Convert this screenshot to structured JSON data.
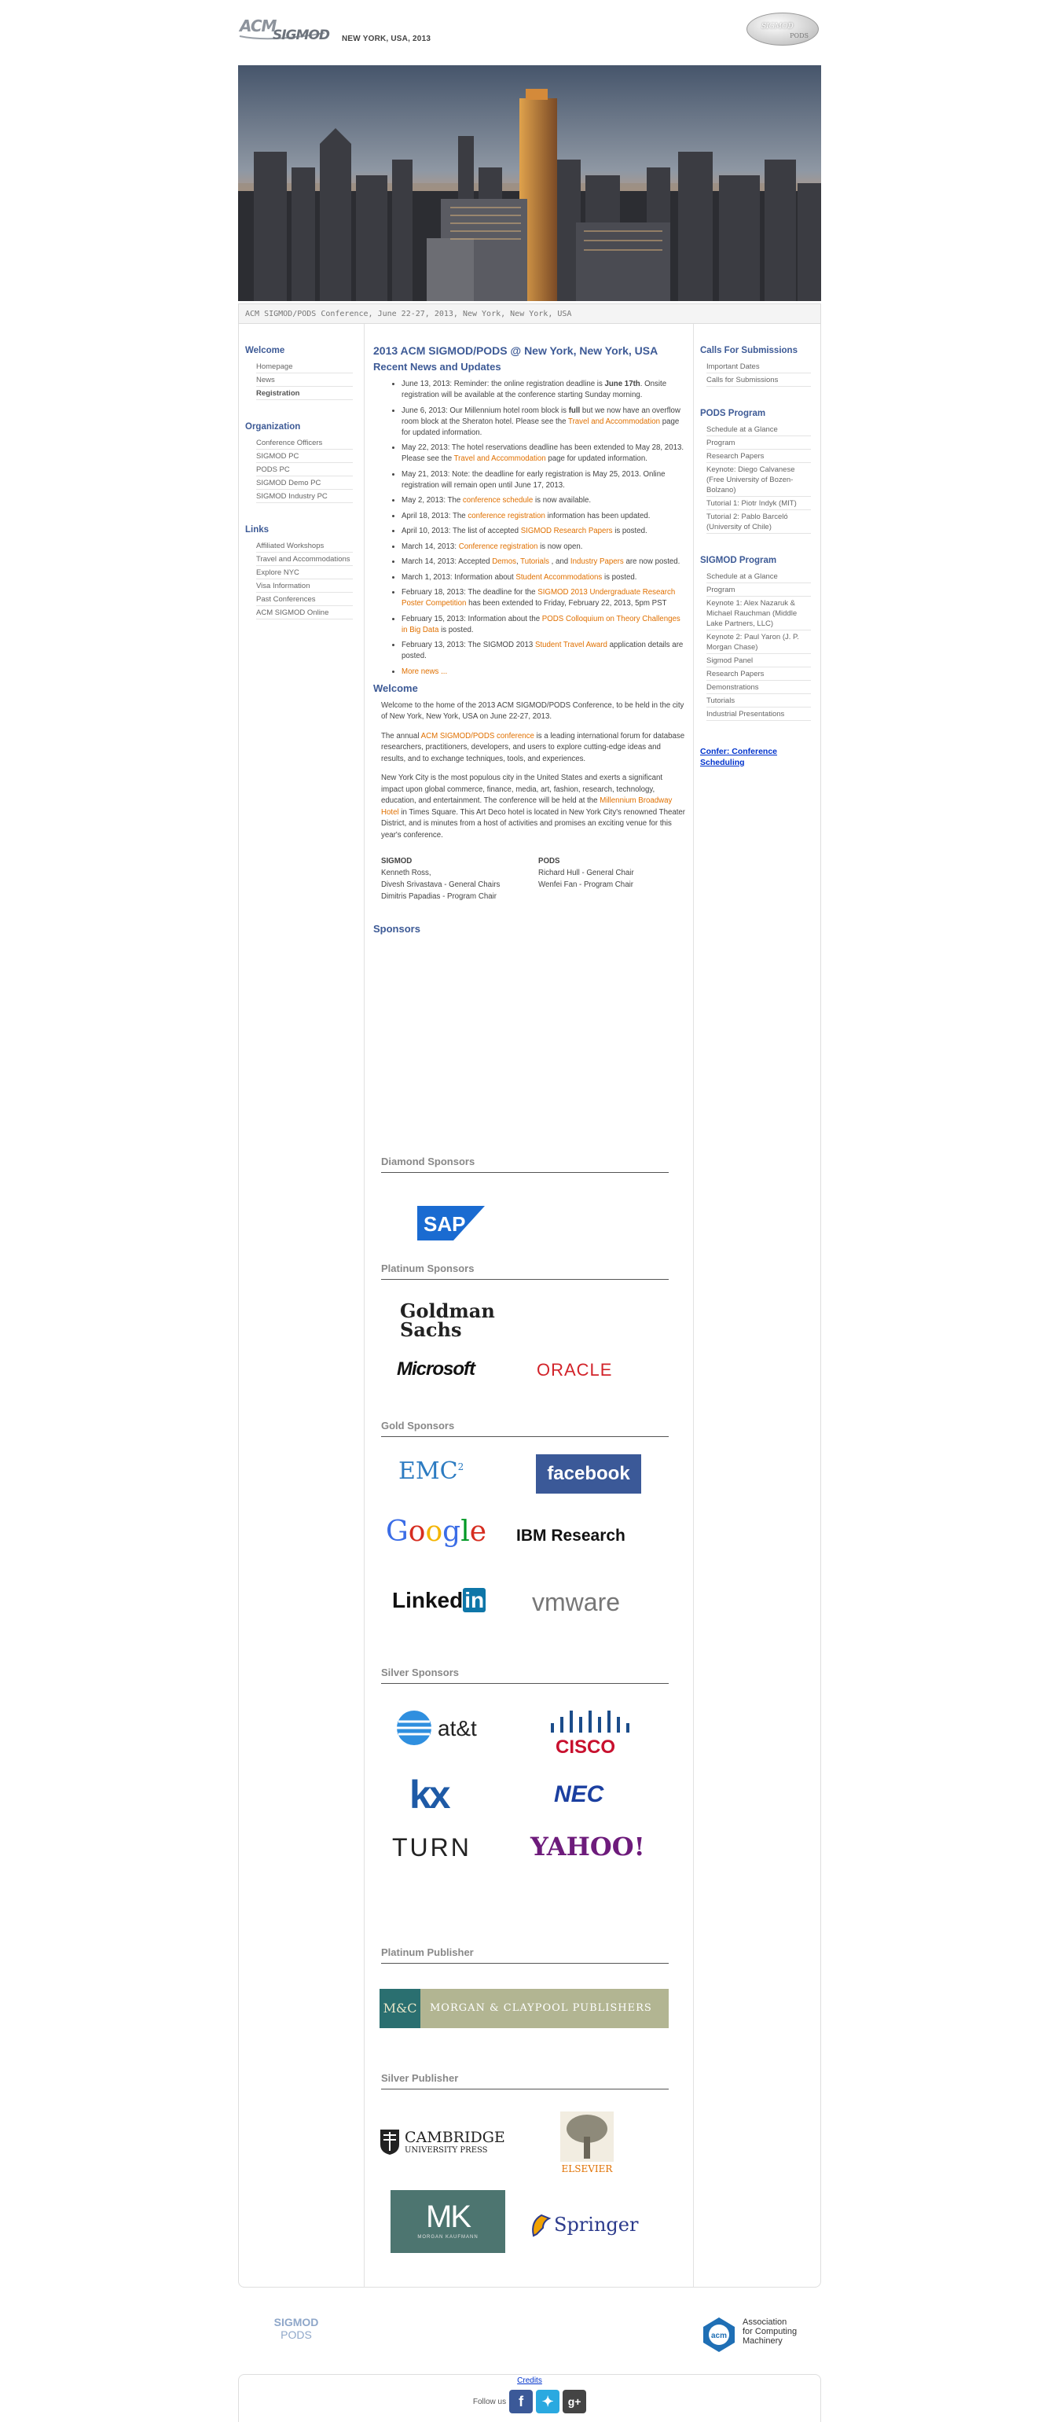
{
  "header": {
    "title": "NEW YORK, USA, 2013",
    "acm_logo_text": "ACM SIGMOD",
    "badge_top": "SIGMOD",
    "badge_bottom": "PODS"
  },
  "caption": "ACM SIGMOD/PODS Conference, June 22-27, 2013, New York, New York, USA",
  "left_sidebar": {
    "sections": [
      {
        "heading": "Welcome",
        "items": [
          "Homepage",
          "News",
          "Registration"
        ]
      },
      {
        "heading": "Organization",
        "items": [
          "Conference Officers",
          "SIGMOD PC",
          "PODS PC",
          "SIGMOD Demo PC",
          "SIGMOD Industry PC"
        ]
      },
      {
        "heading": "Links",
        "items": [
          "Affiliated Workshops",
          "Travel and Accommodations",
          "Explore NYC",
          "Visa Information",
          "Past Conferences",
          "ACM SIGMOD Online"
        ]
      }
    ]
  },
  "right_sidebar": {
    "sections": [
      {
        "heading": "Calls For Submissions",
        "items": [
          "Important Dates",
          "Calls for Submissions"
        ]
      },
      {
        "heading": "PODS Program",
        "items": [
          "Schedule at a Glance",
          "Program",
          "Research Papers",
          "Keynote: Diego Calvanese (Free University of Bozen-Bolzano)",
          "Tutorial 1: Piotr Indyk (MIT)",
          "Tutorial 2: Pablo Barceló (University of Chile)"
        ]
      },
      {
        "heading": "SIGMOD Program",
        "items": [
          "Schedule at a Glance",
          "Program",
          "Keynote 1: Alex Nazaruk & Michael Rauchman (Middle Lake Partners, LLC)",
          "Keynote 2: Paul Yaron (J. P. Morgan Chase)",
          "Sigmod Panel",
          "Research Papers",
          "Demonstrations",
          "Tutorials",
          "Industrial Presentations"
        ]
      }
    ],
    "confer_link": "Confer: Conference Scheduling"
  },
  "main": {
    "title": "2013 ACM SIGMOD/PODS @ New York, New York, USA",
    "news_heading": "Recent News and Updates",
    "news": [
      {
        "pre": "June 13, 2013: Reminder: the online registration deadline is ",
        "bold": "June 17th",
        "post": ". Onsite registration will be available at the conference starting Sunday morning."
      },
      {
        "pre": "June 6, 2013: Our Millennium hotel room block is ",
        "bold": "full",
        "post": " but we now have an overflow room block at the Sheraton hotel. Please see the ",
        "link": "Travel and Accommodation",
        "post2": " page for updated information."
      },
      {
        "pre": "May 22, 2013: The hotel reservations deadline has been extended to May 28, 2013. Please see the ",
        "link": "Travel and Accommodation",
        "post": " page for updated information."
      },
      {
        "pre": "May 21, 2013: Note: the deadline for early registration is May 25, 2013. Online registration will remain open until June 17, 2013."
      },
      {
        "pre": "May 2, 2013: The ",
        "link": "conference schedule",
        "post": " is now available."
      },
      {
        "pre": "April 18, 2013: The ",
        "link": "conference registration",
        "post": " information has been updated."
      },
      {
        "pre": "April 10, 2013: The list of accepted ",
        "link": "SIGMOD Research Papers",
        "post": " is posted."
      },
      {
        "pre": "March 14, 2013: ",
        "link": "Conference registration",
        "post": " is now open."
      },
      {
        "pre": "March 14, 2013: Accepted ",
        "link": "Demos",
        "mid": ", ",
        "link2": "Tutorials",
        "mid2": " , and ",
        "link3": "Industry Papers",
        "post": " are now posted."
      },
      {
        "pre": "March 1, 2013: Information about ",
        "link": "Student Accommodations",
        "post": " is posted."
      },
      {
        "pre": "February 18, 2013: The deadline for the ",
        "link": "SIGMOD 2013 Undergraduate Research Poster Competition",
        "post": " has been extended to Friday, February 22, 2013, 5pm PST"
      },
      {
        "pre": "February 15, 2013: Information about the ",
        "link": "PODS Colloquium on Theory Challenges in Big Data",
        "post": " is posted."
      },
      {
        "pre": "February 13, 2013: The SIGMOD 2013 ",
        "link": "Student Travel Award",
        "post": " application details are posted."
      },
      {
        "link": "More news ..."
      }
    ],
    "welcome_heading": "Welcome",
    "welcome_p1": "Welcome to the home of the 2013 ACM SIGMOD/PODS Conference, to be held in the city of New York, New York, USA on June 22-27, 2013.",
    "welcome_p2_pre": "The annual ",
    "welcome_p2_link": "ACM SIGMOD/PODS conference",
    "welcome_p2_post": " is a leading international forum for database researchers, practitioners, developers, and users to explore cutting-edge ideas and results, and to exchange techniques, tools, and experiences.",
    "welcome_p3_pre": "New York City is the most populous city in the United States and exerts a significant impact upon global commerce, finance, media, art, fashion, research, technology, education, and entertainment. The conference will be held at the ",
    "welcome_p3_link": "Millennium Broadway Hotel",
    "welcome_p3_post": " in Times Square. This Art Deco hotel is located in New York City's renowned Theater District, and is minutes from a host of activities and promises an exciting venue for this year's conference.",
    "chairs": {
      "sigmod_h": "SIGMOD",
      "sigmod_1": "Kenneth Ross,",
      "sigmod_2": "Divesh Srivastava - General Chairs",
      "sigmod_3": "Dimitris Papadias - Program Chair",
      "pods_h": "PODS",
      "pods_1": "Richard Hull - General Chair",
      "pods_2": "Wenfei Fan - Program Chair"
    },
    "sponsors": {
      "heading": "Sponsors",
      "diamond": "Diamond Sponsors",
      "platinum": "Platinum Sponsors",
      "gold": "Gold Sponsors",
      "silver": "Silver Sponsors",
      "platinum_publisher": "Platinum Publisher",
      "silver_publisher": "Silver Publisher",
      "logos": {
        "sap": "SAP",
        "goldman1": "Goldman",
        "goldman2": "Sachs",
        "microsoft": "Microsoft",
        "oracle": "ORACLE",
        "emc": "EMC",
        "emc_sup": "2",
        "facebook": "facebook",
        "google": "Google",
        "ibm": "IBM Research",
        "linkedin1": "Linked",
        "linkedin2": "in",
        "vmware": "vmware",
        "att": "at&t",
        "cisco": "CISCO",
        "kx": "kx",
        "nec": "NEC",
        "turn": "TURN",
        "yahoo": "YAHOO!",
        "morgan": "MORGAN & CLAYPOOL PUBLISHERS",
        "morgan_mark": "M&C",
        "cambridge1": "CAMBRIDGE",
        "cambridge2": "UNIVERSITY PRESS",
        "elsevier": "ELSEVIER",
        "mk": "MK",
        "mk_sub": "MORGAN KAUFMANN",
        "springer": "Springer"
      }
    }
  },
  "footer": {
    "sigmod_pods_1": "SIGMOD",
    "sigmod_pods_2": "PODS",
    "acm1": "Association",
    "acm2": "for Computing",
    "acm3": "Machinery",
    "acm_mark": "acm",
    "credits": "Credits",
    "follow": "Follow us"
  },
  "colors": {
    "heading_blue": "#3d5a96",
    "link_orange": "#e07000",
    "link_blue": "#0033cc"
  }
}
